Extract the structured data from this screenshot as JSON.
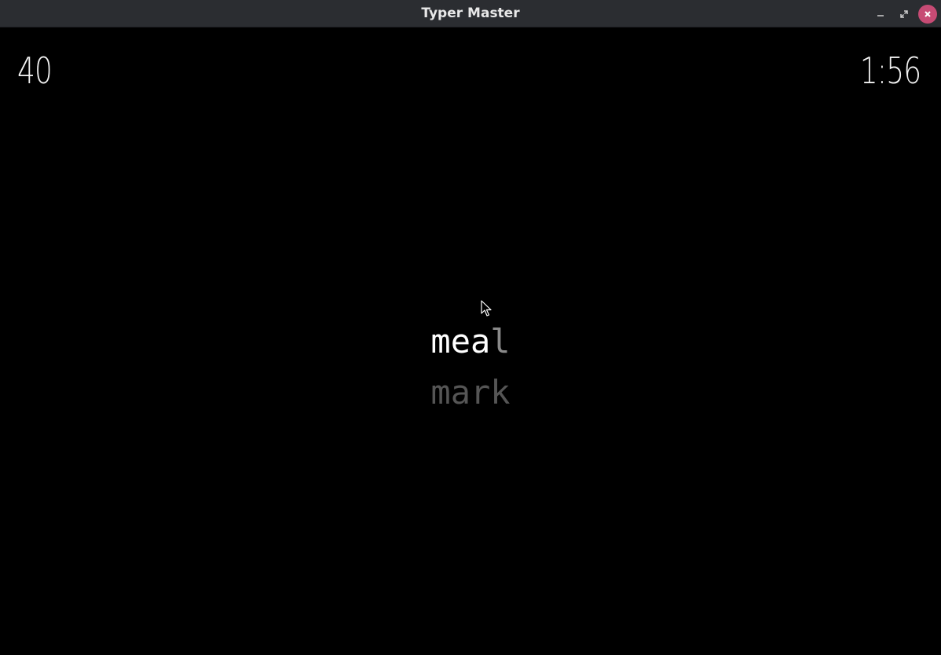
{
  "window": {
    "title": "Typer Master",
    "controls": {
      "minimize": "minimize-icon",
      "maximize": "maximize-icon",
      "close": "close-icon",
      "close_color": "#c74b74"
    }
  },
  "game": {
    "score": "40",
    "timer": "1:56",
    "current_word": {
      "typed": "mea",
      "remaining": "l"
    },
    "next_word": "mark"
  },
  "colors": {
    "background": "#000000",
    "typed": "#ffffff",
    "untyped": "#8a8a8a",
    "next": "#555555"
  }
}
